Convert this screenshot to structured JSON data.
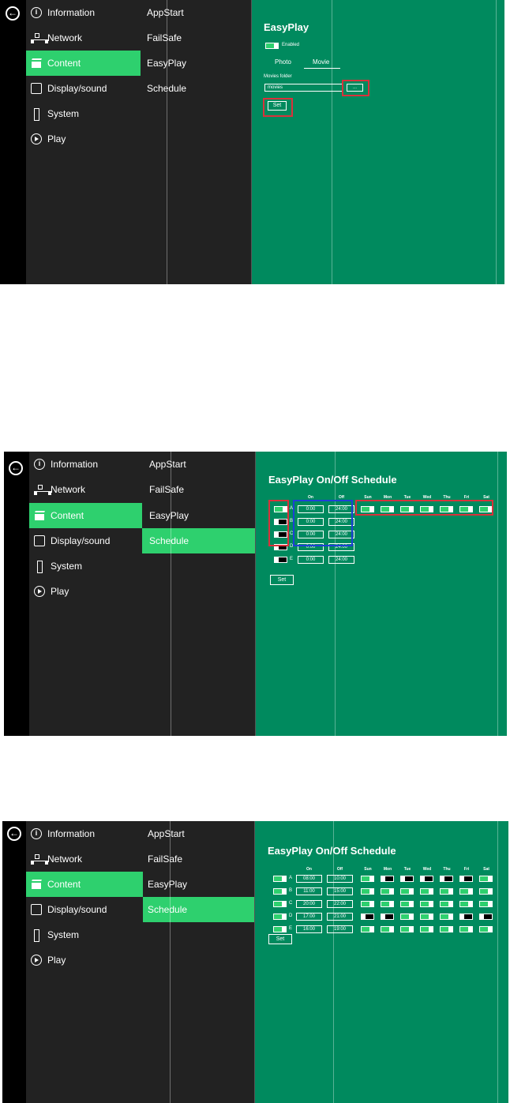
{
  "menu": {
    "items": [
      {
        "label": "Information",
        "icon": "info-icon"
      },
      {
        "label": "Network",
        "icon": "network-icon"
      },
      {
        "label": "Content",
        "icon": "content-icon"
      },
      {
        "label": "Display/sound",
        "icon": "display-icon"
      },
      {
        "label": "System",
        "icon": "system-icon"
      },
      {
        "label": "Play",
        "icon": "play-icon"
      }
    ],
    "sub_items": [
      "AppStart",
      "FailSafe",
      "EasyPlay",
      "Schedule"
    ]
  },
  "shot1": {
    "title": "EasyPlay",
    "enabled_label": "Enabled",
    "tab_photo": "Photo",
    "tab_movie": "Movie",
    "folder_label": "Movies folder",
    "folder_value": "movies",
    "browse_label": "...",
    "set_label": "Set"
  },
  "schedule": {
    "title": "EasyPlay On/Off Schedule",
    "col_on": "On",
    "col_off": "Off",
    "days": [
      "Sun",
      "Mon",
      "Tue",
      "Wed",
      "Thu",
      "Fri",
      "Sat"
    ],
    "row_labels": [
      "A",
      "B",
      "C",
      "D",
      "E"
    ],
    "set_label": "Set"
  },
  "shot2": {
    "rows": [
      {
        "on": "0:00",
        "off": "24:00"
      },
      {
        "on": "0:00",
        "off": "24:00"
      },
      {
        "on": "0:00",
        "off": "24:00"
      },
      {
        "on": "0:00",
        "off": "24:00"
      },
      {
        "on": "0:00",
        "off": "24:00"
      }
    ],
    "row_enabled": [
      true,
      false,
      false,
      false,
      false
    ],
    "sun_row_days": [
      true,
      true,
      true,
      true,
      true,
      true,
      true
    ]
  },
  "shot3": {
    "rows": [
      {
        "on": "08:00",
        "off": "10:00",
        "enabled": true,
        "days": [
          true,
          false,
          false,
          false,
          false,
          false,
          true
        ]
      },
      {
        "on": "11:00",
        "off": "15:00",
        "enabled": true,
        "days": [
          true,
          true,
          true,
          true,
          true,
          true,
          true
        ]
      },
      {
        "on": "20:00",
        "off": "22:00",
        "enabled": true,
        "days": [
          true,
          true,
          true,
          true,
          true,
          true,
          true
        ]
      },
      {
        "on": "17:00",
        "off": "21:00",
        "enabled": true,
        "days": [
          false,
          false,
          true,
          true,
          true,
          false,
          false
        ]
      },
      {
        "on": "16:00",
        "off": "19:00",
        "enabled": true,
        "days": [
          true,
          true,
          true,
          true,
          true,
          true,
          true
        ]
      }
    ]
  },
  "colors": {
    "panel_green": "#008a5e",
    "accent_green": "#2ed06e",
    "menu_dark": "#222222",
    "highlight_red": "#d9323b",
    "highlight_blue": "#1f3fd6"
  }
}
